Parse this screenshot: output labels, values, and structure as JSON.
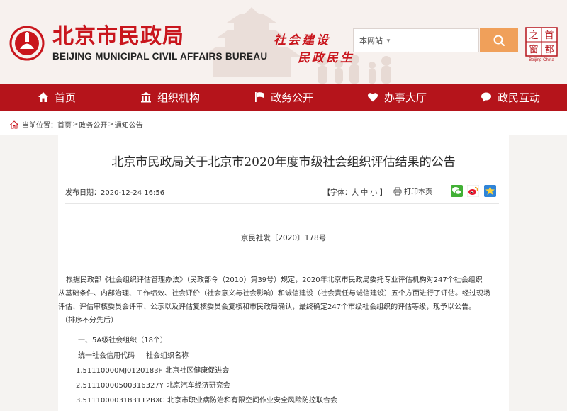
{
  "header": {
    "site_title": "北京市民政局",
    "site_subtitle": "BEIJING MUNICIPAL CIVIL AFFAIRS BUREAU",
    "slogan_line1": "社会建设",
    "slogan_line2": "民政民生",
    "brand_color": "#c9161d",
    "capital_logo_text": "首都之窗",
    "capital_logo_caption": "Beijing·China"
  },
  "search": {
    "scope": "本网站",
    "value": "",
    "placeholder": "",
    "button_color": "#f0a05a",
    "button_icon": "search-icon"
  },
  "nav": {
    "background": "#b5141b",
    "items": [
      {
        "label": "首页",
        "icon": "home-icon"
      },
      {
        "label": "组织机构",
        "icon": "building-icon"
      },
      {
        "label": "政务公开",
        "icon": "flag-icon"
      },
      {
        "label": "办事大厅",
        "icon": "heart-icon"
      },
      {
        "label": "政民互动",
        "icon": "chat-icon"
      }
    ]
  },
  "breadcrumb": {
    "label": "当前位置：",
    "items": [
      "首页",
      "政务公开",
      "通知公告"
    ],
    "separator": ">"
  },
  "article": {
    "title": "北京市民政局关于北京市2020年度市级社会组织评估结果的公告",
    "date_label": "发布日期：",
    "date": "2020-12-24 16:56",
    "font_label": "【字体：",
    "font_large": "大",
    "font_medium": "中",
    "font_small": "小",
    "font_end": "】",
    "print_label": "打印本页",
    "share_icons": [
      "wechat-icon",
      "weibo-icon",
      "qzone-icon"
    ],
    "doc_number": "京民社发〔2020〕178号",
    "paragraph_lines": [
      "根据民政部《社会组织评估管理办法》（民政部令（2010）第39号）规定，2020年北京市民政局委托专业评估机构对247个社会组织",
      "从基础条件、内部治理、工作绩效、社会评价（社会意义与社会影响）和诚信建设（社会责任与诚信建设）五个方面进行了评估。经过现场",
      "评估、评估审核委员会评审、公示以及评估复核委员会复核和市民政局确认，最终确定247个市级社会组织的评估等级，现予以公告。",
      "（排序不分先后）"
    ],
    "section_heading": "一、5A级社会组织（18个）",
    "col_code": "统一社会信用代码",
    "col_name": "社会组织名称",
    "orgs": [
      {
        "code": "1.51110000MJ0120183F",
        "name": "北京社区健康促进会"
      },
      {
        "code": "2.51110000500316327Y",
        "name": "北京汽车经济研究会"
      },
      {
        "code": "3.511100003183112BXC",
        "name": "北京市职业病防治和有限空间作业安全风险防控联合会"
      }
    ]
  }
}
